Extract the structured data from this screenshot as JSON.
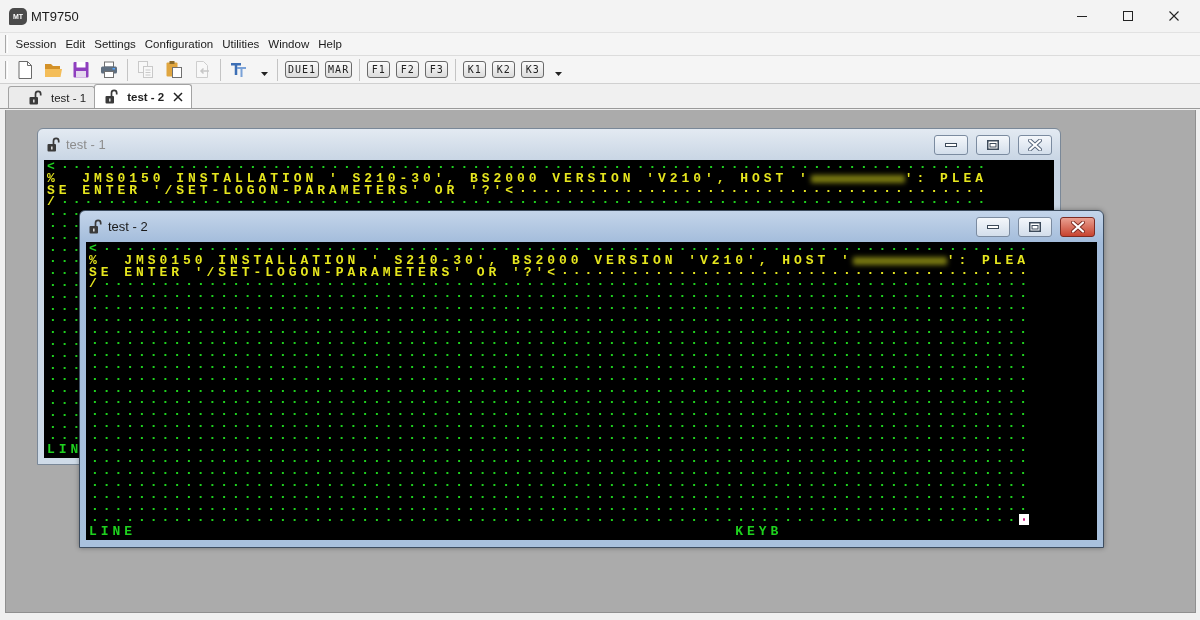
{
  "app": {
    "logo_text": "MT",
    "title": "MT9750"
  },
  "menu": [
    "Session",
    "Edit",
    "Settings",
    "Configuration",
    "Utilities",
    "Window",
    "Help"
  ],
  "toolbar": {
    "file_buttons": [
      {
        "disabled": false
      },
      {
        "disabled": false
      },
      {
        "disabled": false
      },
      {
        "disabled": false
      }
    ],
    "clipboard_buttons": [
      {
        "disabled": true
      },
      {
        "disabled": false
      },
      {
        "disabled": true
      }
    ],
    "emulation_keys": [
      "DUE1",
      "MAR"
    ],
    "function_keys": [
      "F1",
      "F2",
      "F3"
    ],
    "k_keys": [
      "K1",
      "K2",
      "K3"
    ]
  },
  "tabs": [
    {
      "label": "test - 1",
      "selected": false
    },
    {
      "label": "test - 2",
      "selected": true
    }
  ],
  "windows": [
    {
      "title": "test - 1",
      "active": false,
      "rows": [
        {
          "segments": [
            {
              "kind": "text",
              "text": "<",
              "color": "#1ed21e"
            }
          ],
          "fill": {
            "color": "#1ed21e"
          }
        },
        {
          "segments": [
            {
              "kind": "text",
              "text": "%  JMS0150 INSTALLATION ' S210-30', BS2000 VERSION 'V210', HOST '",
              "color": "#e6e61e"
            },
            {
              "kind": "blurred",
              "color": "#7a7a12"
            },
            {
              "kind": "text",
              "text": "': PLEA",
              "color": "#e6e61e"
            }
          ]
        },
        {
          "segments": [
            {
              "kind": "text",
              "text": "SE ENTER '/SET-LOGON-PARAMETERS' OR '?'<",
              "color": "#e6e61e"
            }
          ],
          "fill": {
            "color": "#e6e61e"
          }
        },
        {
          "segments": [
            {
              "kind": "text",
              "text": "/",
              "color": "#e6e61e"
            }
          ],
          "fill": {
            "color": "#1ed21e"
          }
        },
        {
          "fill": {
            "color": "#1ed21e"
          }
        },
        {
          "fill": {
            "color": "#1ed21e"
          }
        },
        {
          "fill": {
            "color": "#1ed21e"
          }
        },
        {
          "fill": {
            "color": "#1ed21e"
          }
        },
        {
          "fill": {
            "color": "#1ed21e"
          }
        },
        {
          "fill": {
            "color": "#1ed21e"
          }
        },
        {
          "fill": {
            "color": "#1ed21e"
          }
        },
        {
          "fill": {
            "color": "#1ed21e"
          }
        },
        {
          "fill": {
            "color": "#1ed21e"
          }
        },
        {
          "fill": {
            "color": "#1ed21e"
          }
        },
        {
          "fill": {
            "color": "#1ed21e"
          }
        },
        {
          "fill": {
            "color": "#1ed21e"
          }
        },
        {
          "fill": {
            "color": "#1ed21e"
          }
        },
        {
          "fill": {
            "color": "#1ed21e"
          }
        },
        {
          "fill": {
            "color": "#1ed21e"
          }
        },
        {
          "fill": {
            "color": "#1ed21e"
          }
        },
        {
          "fill": {
            "color": "#1ed21e"
          }
        },
        {
          "fill": {
            "color": "#1ed21e"
          }
        },
        {
          "fill": {
            "color": "#1ed21e"
          }
        },
        {
          "fill": {
            "color": "#1ed21e"
          }
        }
      ],
      "status": [
        {
          "text": "LIN"
        }
      ]
    },
    {
      "title": "test - 2",
      "active": true,
      "rows": [
        {
          "segments": [
            {
              "kind": "text",
              "text": "<",
              "color": "#1ed21e"
            }
          ],
          "fill": {
            "color": "#1ed21e"
          },
          "cursor": false
        },
        {
          "segments": [
            {
              "kind": "text",
              "text": "%  JMS0150 INSTALLATION ' S210-30', BS2000 VERSION 'V210', HOST '",
              "color": "#e6e61e"
            },
            {
              "kind": "blurred",
              "color": "#7a7a12"
            },
            {
              "kind": "text",
              "text": "': PLEA",
              "color": "#e6e61e"
            }
          ],
          "cursor": false
        },
        {
          "segments": [
            {
              "kind": "text",
              "text": "SE ENTER '/SET-LOGON-PARAMETERS' OR '?'<",
              "color": "#e6e61e"
            }
          ],
          "fill": {
            "color": "#e6e61e"
          },
          "cursor": false
        },
        {
          "segments": [
            {
              "kind": "text",
              "text": "/",
              "color": "#e6e61e"
            }
          ],
          "fill": {
            "color": "#1ed21e"
          },
          "cursor": false
        },
        {
          "fill": {
            "color": "#1ed21e"
          },
          "cursor": false
        },
        {
          "fill": {
            "color": "#1ed21e"
          },
          "cursor": false
        },
        {
          "fill": {
            "color": "#1ed21e"
          },
          "cursor": false
        },
        {
          "fill": {
            "color": "#1ed21e"
          },
          "cursor": false
        },
        {
          "fill": {
            "color": "#1ed21e"
          },
          "cursor": false
        },
        {
          "fill": {
            "color": "#1ed21e"
          },
          "cursor": false
        },
        {
          "fill": {
            "color": "#1ed21e"
          },
          "cursor": false
        },
        {
          "fill": {
            "color": "#1ed21e"
          },
          "cursor": false
        },
        {
          "fill": {
            "color": "#1ed21e"
          },
          "cursor": false
        },
        {
          "fill": {
            "color": "#1ed21e"
          },
          "cursor": false
        },
        {
          "fill": {
            "color": "#1ed21e"
          },
          "cursor": false
        },
        {
          "fill": {
            "color": "#1ed21e"
          },
          "cursor": false
        },
        {
          "fill": {
            "color": "#1ed21e"
          },
          "cursor": false
        },
        {
          "fill": {
            "color": "#1ed21e"
          },
          "cursor": false
        },
        {
          "fill": {
            "color": "#1ed21e"
          },
          "cursor": false
        },
        {
          "fill": {
            "color": "#1ed21e"
          },
          "cursor": false
        },
        {
          "fill": {
            "color": "#1ed21e"
          },
          "cursor": false
        },
        {
          "fill": {
            "color": "#1ed21e"
          },
          "cursor": false
        },
        {
          "fill": {
            "color": "#1ed21e"
          },
          "cursor": false
        },
        {
          "fill": {
            "color": "#1ed21e"
          },
          "cursor": true
        }
      ],
      "status": [
        {
          "text": "LINE"
        },
        {
          "text": "KEYB"
        }
      ]
    }
  ]
}
